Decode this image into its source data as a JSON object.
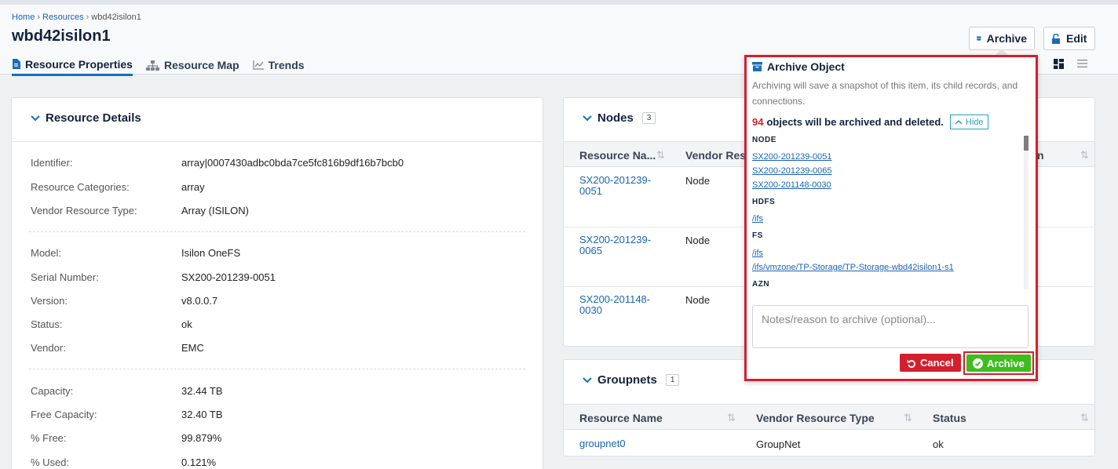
{
  "breadcrumb": {
    "items": [
      "Home",
      "Resources"
    ],
    "current": "wbd42isilon1",
    "separator": "›"
  },
  "page": {
    "title": "wbd42isilon1"
  },
  "tabs": [
    "Resource Properties",
    "Resource Map",
    "Trends"
  ],
  "header_buttons": {
    "archive": "Archive",
    "edit": "Edit"
  },
  "resource_details": {
    "title": "Resource Details",
    "rows": [
      {
        "label": "Identifier:",
        "value": "array|0007430adbc0bda7ce5fc816b9df16b7bcb0"
      },
      {
        "label": "Resource Categories:",
        "value": "array"
      },
      {
        "label": "Vendor Resource Type:",
        "value": "Array (ISILON)"
      },
      {
        "label": "Model:",
        "value": "Isilon OneFS"
      },
      {
        "label": "Serial Number:",
        "value": "SX200-201239-0051"
      },
      {
        "label": "Version:",
        "value": "v8.0.0.7"
      },
      {
        "label": "Status:",
        "value": "ok"
      },
      {
        "label": "Vendor:",
        "value": "EMC"
      },
      {
        "label": "Capacity:",
        "value": "32.44 TB"
      },
      {
        "label": "Free Capacity:",
        "value": "32.40 TB"
      },
      {
        "label": "% Free:",
        "value": "99.879%"
      },
      {
        "label": "% Used:",
        "value": "0.121%"
      }
    ]
  },
  "nodes": {
    "title": "Nodes",
    "count": "3",
    "columns": [
      "Resource Na...",
      "Vendor Res",
      "n"
    ],
    "rows": [
      {
        "name_l1": "SX200-201239-",
        "name_l2": "0051",
        "type": "Node"
      },
      {
        "name_l1": "SX200-201239-",
        "name_l2": "0065",
        "type": "Node"
      },
      {
        "name_l1": "SX200-201148-",
        "name_l2": "0030",
        "type": "Node"
      }
    ]
  },
  "groupnets": {
    "title": "Groupnets",
    "count": "1",
    "columns": [
      "Resource Name",
      "Vendor Resource Type",
      "Status"
    ],
    "rows": [
      {
        "name": "groupnet0",
        "type": "GroupNet",
        "status": "ok"
      }
    ]
  },
  "archive_popup": {
    "title": "Archive Object",
    "description": "Archiving will save a snapshot of this item, its child records, and connections.",
    "count": "94",
    "count_text": "objects will be archived and deleted.",
    "hide_label": "Hide",
    "groups": [
      {
        "heading": "NODE",
        "items": [
          "SX200-201239-0051",
          "SX200-201239-0065",
          "SX200-201148-0030"
        ]
      },
      {
        "heading": "HDFS",
        "items": [
          "/ifs"
        ]
      },
      {
        "heading": "FS",
        "items": [
          "/ifs",
          "/ifs/vmzone/TP-Storage/TP-Storage-wbd42isilon1-s1"
        ]
      },
      {
        "heading": "AZN",
        "items": []
      }
    ],
    "notes_placeholder": "Notes/reason to archive (optional)...",
    "cancel_label": "Cancel",
    "archive_label": "Archive"
  },
  "colors": {
    "accent": "#1b6db8",
    "danger": "#d2202f",
    "success": "#3fbd1f",
    "title": "#13223d"
  }
}
